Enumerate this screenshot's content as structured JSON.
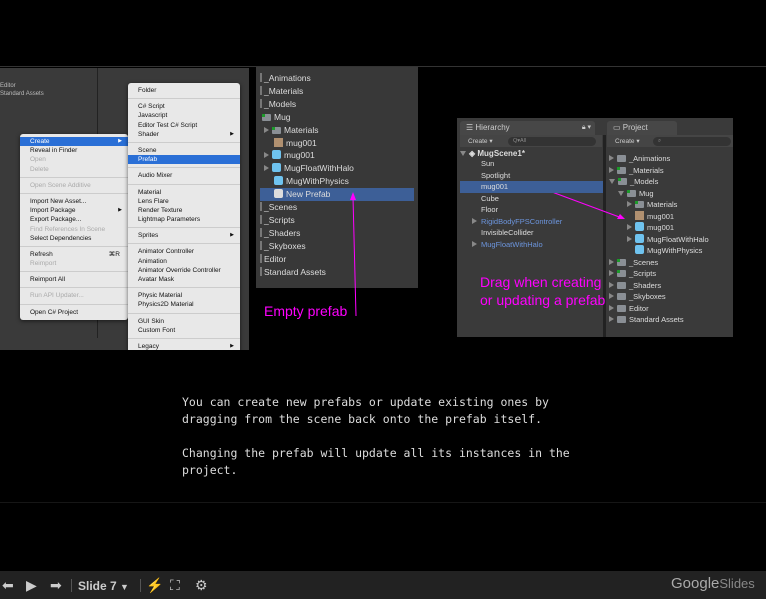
{
  "image1": {
    "project_items": [
      "Editor",
      "Standard Assets"
    ],
    "context_menu": [
      {
        "label": "Create",
        "selected": true,
        "submenu": true
      },
      {
        "label": "Reveal in Finder"
      },
      {
        "label": "Open",
        "disabled": true
      },
      {
        "label": "Delete",
        "disabled": true
      },
      {
        "sep": true
      },
      {
        "label": "Open Scene Additive",
        "disabled": true
      },
      {
        "sep": true
      },
      {
        "label": "Import New Asset..."
      },
      {
        "label": "Import Package",
        "submenu": true
      },
      {
        "label": "Export Package..."
      },
      {
        "label": "Find References In Scene",
        "disabled": true
      },
      {
        "label": "Select Dependencies"
      },
      {
        "sep": true
      },
      {
        "label": "Refresh",
        "shortcut": "⌘R"
      },
      {
        "label": "Reimport",
        "disabled": true
      },
      {
        "sep": true
      },
      {
        "label": "Reimport All"
      },
      {
        "sep": true
      },
      {
        "label": "Run API Updater...",
        "disabled": true
      },
      {
        "sep": true
      },
      {
        "label": "Open C# Project"
      }
    ],
    "create_submenu": [
      {
        "label": "Folder"
      },
      {
        "sep": true
      },
      {
        "label": "C# Script"
      },
      {
        "label": "Javascript"
      },
      {
        "label": "Editor Test C# Script"
      },
      {
        "label": "Shader",
        "submenu": true
      },
      {
        "sep": true
      },
      {
        "label": "Scene"
      },
      {
        "label": "Prefab",
        "selected": true
      },
      {
        "sep": true
      },
      {
        "label": "Audio Mixer"
      },
      {
        "sep": true
      },
      {
        "label": "Material"
      },
      {
        "label": "Lens Flare"
      },
      {
        "label": "Render Texture"
      },
      {
        "label": "Lightmap Parameters"
      },
      {
        "sep": true
      },
      {
        "label": "Sprites",
        "submenu": true
      },
      {
        "sep": true
      },
      {
        "label": "Animator Controller"
      },
      {
        "label": "Animation"
      },
      {
        "label": "Animator Override Controller"
      },
      {
        "label": "Avatar Mask"
      },
      {
        "sep": true
      },
      {
        "label": "Physic Material"
      },
      {
        "label": "Physics2D Material"
      },
      {
        "sep": true
      },
      {
        "label": "GUI Skin"
      },
      {
        "label": "Custom Font"
      },
      {
        "sep": true
      },
      {
        "label": "Legacy",
        "submenu": true
      }
    ]
  },
  "image2": {
    "tree": [
      {
        "label": "_Animations",
        "indent": 0,
        "icon": "folder"
      },
      {
        "label": "_Materials",
        "indent": 0,
        "icon": "folder"
      },
      {
        "label": "_Models",
        "indent": 0,
        "icon": "folder"
      },
      {
        "label": "Mug",
        "indent": 0,
        "icon": "folder-green"
      },
      {
        "label": "Materials",
        "indent": 1,
        "icon": "folder-green",
        "expander": true
      },
      {
        "label": "mug001",
        "indent": 1,
        "icon": "texture"
      },
      {
        "label": "mug001",
        "indent": 1,
        "icon": "prefab-cube",
        "expander": true
      },
      {
        "label": "MugFloatWithHalo",
        "indent": 1,
        "icon": "prefab-cube",
        "expander": true
      },
      {
        "label": "MugWithPhysics",
        "indent": 1,
        "icon": "prefab-cube"
      },
      {
        "label": "New Prefab",
        "indent": 1,
        "icon": "empty-prefab",
        "selected": true
      },
      {
        "label": "_Scenes",
        "indent": 0,
        "icon": "folder"
      },
      {
        "label": "_Scripts",
        "indent": 0,
        "icon": "folder"
      },
      {
        "label": "_Shaders",
        "indent": 0,
        "icon": "folder"
      },
      {
        "label": "_Skyboxes",
        "indent": 0,
        "icon": "folder"
      },
      {
        "label": "Editor",
        "indent": 0,
        "icon": "folder"
      },
      {
        "label": "Standard Assets",
        "indent": 0,
        "icon": "folder"
      }
    ],
    "annotation": "Empty prefab",
    "annotation_color": "#ff00ff"
  },
  "image3": {
    "hierarchy_tab": "Hierarchy",
    "project_tab": "Project",
    "create_label": "Create ▾",
    "search_placeholder": "Q▾All",
    "scene_name": "MugScene1*",
    "hierarchy": [
      {
        "label": "Sun"
      },
      {
        "label": "Spotlight"
      },
      {
        "label": "mug001",
        "selected": true
      },
      {
        "label": "Cube"
      },
      {
        "label": "Floor"
      },
      {
        "label": "RigidBodyFPSController",
        "prefab": true,
        "expander": true
      },
      {
        "label": "InvisibleCollider"
      },
      {
        "label": "MugFloatWithHalo",
        "prefab": true,
        "expander": true
      }
    ],
    "project": [
      {
        "label": "_Animations",
        "indent": 0,
        "icon": "folder",
        "exp": "right"
      },
      {
        "label": "_Materials",
        "indent": 0,
        "icon": "folder-green",
        "exp": "right"
      },
      {
        "label": "_Models",
        "indent": 0,
        "icon": "folder-green",
        "exp": "down"
      },
      {
        "label": "Mug",
        "indent": 1,
        "icon": "folder-green",
        "exp": "down"
      },
      {
        "label": "Materials",
        "indent": 2,
        "icon": "folder-green",
        "exp": "right"
      },
      {
        "label": "mug001",
        "indent": 2,
        "icon": "texture"
      },
      {
        "label": "mug001",
        "indent": 2,
        "icon": "prefab-cube",
        "exp": "right"
      },
      {
        "label": "MugFloatWithHalo",
        "indent": 2,
        "icon": "prefab-cube",
        "exp": "right"
      },
      {
        "label": "MugWithPhysics",
        "indent": 2,
        "icon": "prefab-cube"
      },
      {
        "label": "_Scenes",
        "indent": 0,
        "icon": "folder-green",
        "exp": "right"
      },
      {
        "label": "_Scripts",
        "indent": 0,
        "icon": "folder-green",
        "exp": "right"
      },
      {
        "label": "_Shaders",
        "indent": 0,
        "icon": "folder",
        "exp": "right"
      },
      {
        "label": "_Skyboxes",
        "indent": 0,
        "icon": "folder",
        "exp": "right"
      },
      {
        "label": "Editor",
        "indent": 0,
        "icon": "folder",
        "exp": "right"
      },
      {
        "label": "Standard Assets",
        "indent": 0,
        "icon": "folder",
        "exp": "right"
      }
    ],
    "annotation_line1": "Drag when creating",
    "annotation_line2": "or updating a prefab"
  },
  "description": {
    "p1": "You can create new prefabs or update existing ones by dragging from the scene back onto the prefab itself.",
    "p2": "Changing the prefab will update all its instances in the project."
  },
  "footer": {
    "slide_label": "Slide 7",
    "brand_google": "Google",
    "brand_slides": "Slides"
  }
}
